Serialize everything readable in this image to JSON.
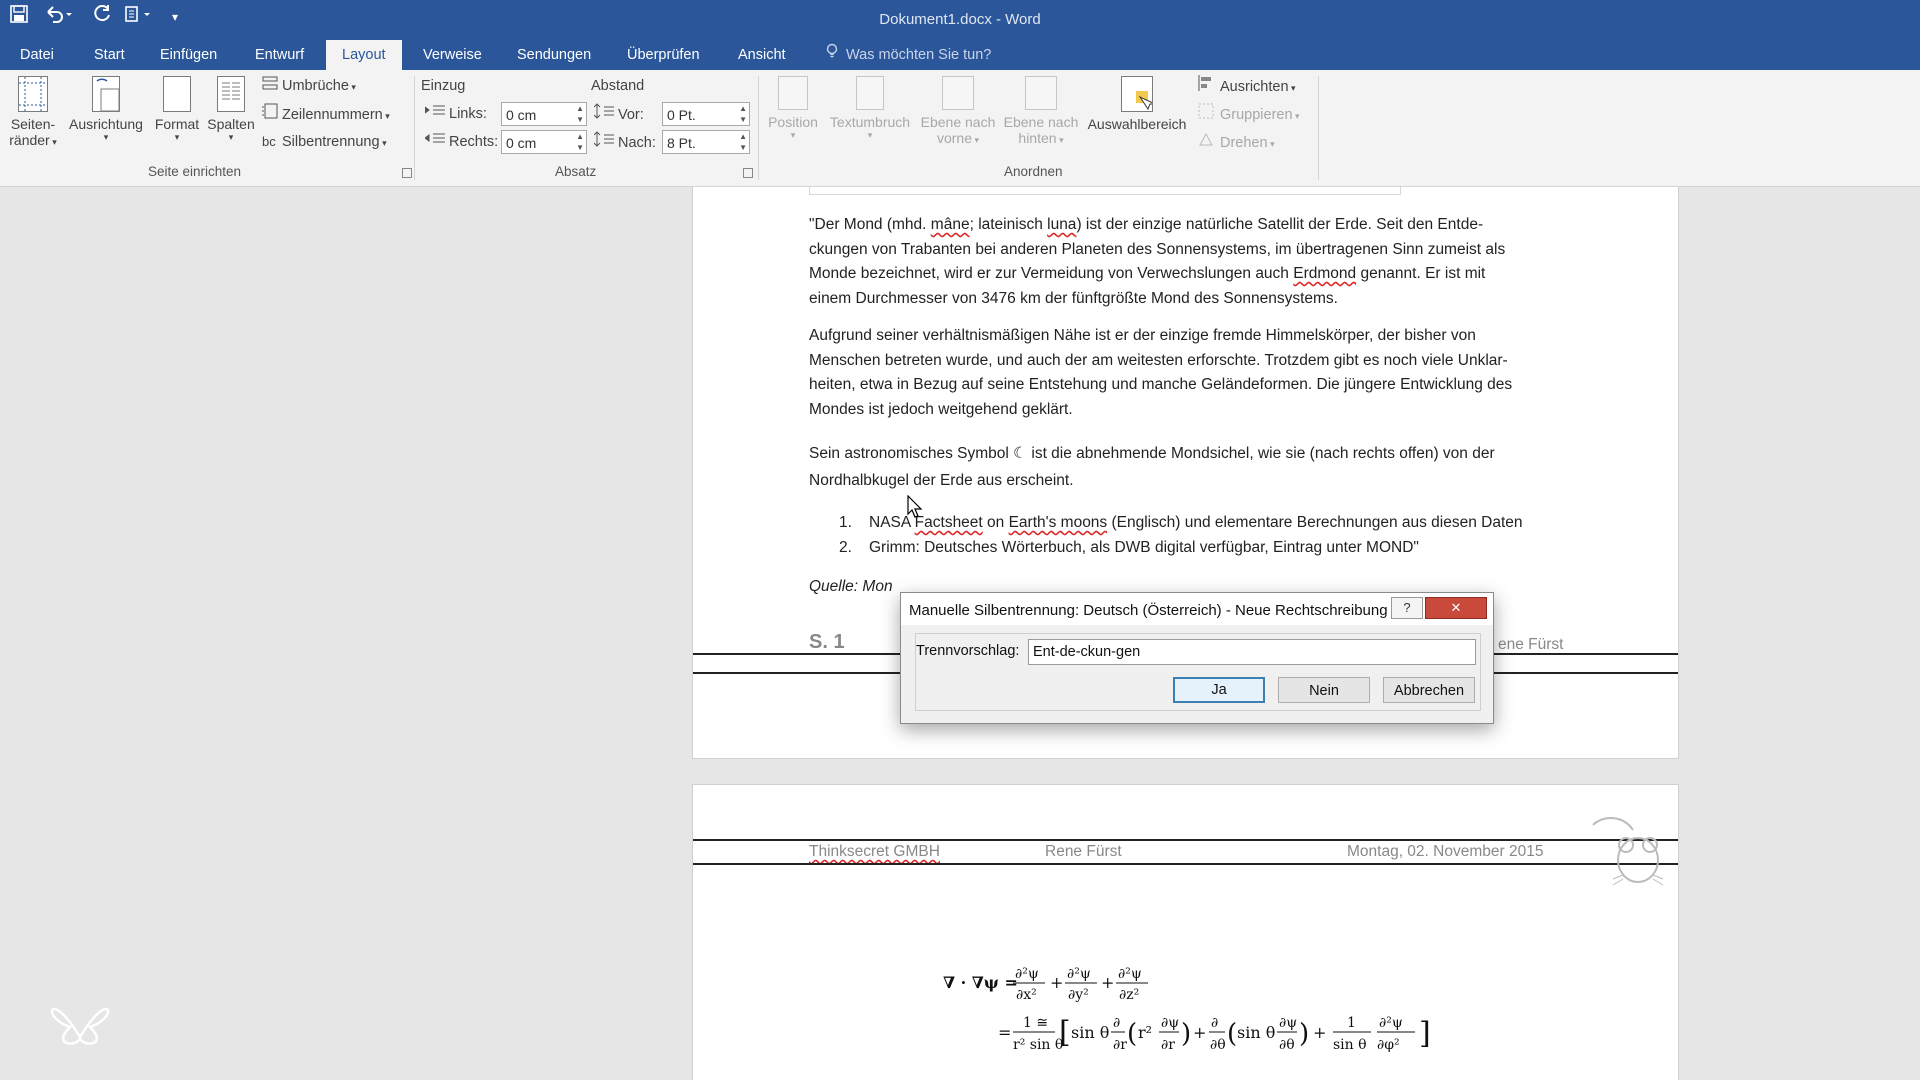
{
  "window": {
    "title": "Dokument1.docx - Word"
  },
  "tabs": [
    {
      "label": "Datei"
    },
    {
      "label": "Start"
    },
    {
      "label": "Einfügen"
    },
    {
      "label": "Entwurf"
    },
    {
      "label": "Layout"
    },
    {
      "label": "Verweise"
    },
    {
      "label": "Sendungen"
    },
    {
      "label": "Überprüfen"
    },
    {
      "label": "Ansicht"
    }
  ],
  "tell_me": "Was möchten Sie tun?",
  "ribbon": {
    "seite_einrichten": {
      "label": "Seite einrichten",
      "seitenraender_1": "Seiten-",
      "seitenraender_2": "ränder",
      "ausrichtung": "Ausrichtung",
      "format": "Format",
      "spalten": "Spalten",
      "umbrueche": "Umbrüche",
      "zeilennummern": "Zeilennummern",
      "silbentrennung": "Silbentrennung"
    },
    "absatz": {
      "label": "Absatz",
      "einzug": "Einzug",
      "abstand": "Abstand",
      "links_label": "Links:",
      "links_value": "0 cm",
      "rechts_label": "Rechts:",
      "rechts_value": "0 cm",
      "vor_label": "Vor:",
      "vor_value": "0 Pt.",
      "nach_label": "Nach:",
      "nach_value": "8 Pt."
    },
    "anordnen": {
      "label": "Anordnen",
      "position": "Position",
      "textumbruch": "Textumbruch",
      "ebene_vorne_1": "Ebene nach",
      "ebene_vorne_2": "vorne",
      "ebene_hinten_1": "Ebene nach",
      "ebene_hinten_2": "hinten",
      "auswahlbereich": "Auswahlbereich",
      "ausrichten": "Ausrichten",
      "gruppieren": "Gruppieren",
      "drehen": "Drehen"
    }
  },
  "document": {
    "para1": {
      "a": "\"Der Mond (mhd. ",
      "b": "mâne",
      "c": "; lateinisch ",
      "d": "luna",
      "e": ") ist der einzige natürliche Satellit der Erde. Seit den Entde-",
      "line2": "ckungen von Trabanten bei anderen Planeten des Sonnensystems, im übertragenen Sinn zumeist als",
      "l3a": "Monde bezeichnet, wird er zur Vermeidung von Verwechslungen auch ",
      "l3b": "Erdmond",
      "l3c": " genannt. Er ist mit",
      "line4": "einem Durchmesser von 3476 km der fünftgrößte Mond des Sonnensystems."
    },
    "para2": [
      "Aufgrund seiner verhältnismäßigen Nähe ist er der einzige fremde Himmelskörper, der bisher von",
      "Menschen betreten wurde, und auch der am weitesten erforschte. Trotzdem gibt es noch viele Unklar-",
      "heiten, etwa in Bezug auf seine Entstehung und manche Geländeformen. Die jüngere Entwicklung des",
      "Mondes ist jedoch weitgehend geklärt."
    ],
    "para3": [
      "Sein astronomisches Symbol ☾ ist die abnehmende Mondsichel, wie sie (nach rechts offen) von der",
      "Nordhalbkugel der Erde aus erscheint."
    ],
    "list": [
      {
        "num": "1.",
        "a": "NASA ",
        "b": "Factsheet",
        "c": " on ",
        "d": "Earth's moons",
        "e": " (Englisch) und elementare Berechnungen aus diesen Daten"
      },
      {
        "num": "2.",
        "text": "Grimm: Deutsches Wörterbuch, als DWB digital verfügbar, Eintrag unter MOND\""
      }
    ],
    "quelle": "Quelle: Mon",
    "page1_footer": {
      "page": "S. 1",
      "right": "ene Fürst"
    },
    "page2_header": {
      "company": "Thinksecret GMBH",
      "author": "Rene Fürst",
      "date": "Montag, 02. November 2015"
    }
  },
  "dialog": {
    "title": "Manuelle Silbentrennung: Deutsch (Österreich) - Neue Rechtschreibung",
    "help": "?",
    "close": "✕",
    "field_label": "Trennvorschlag:",
    "field_value": "Ent-de-ckun-gen",
    "yes": "Ja",
    "no": "Nein",
    "cancel": "Abbrechen"
  },
  "icons": {
    "save": "save-icon",
    "undo": "undo-icon",
    "redo": "redo-icon",
    "lightbulb": "lightbulb-icon",
    "mouse_logo": "mouse-logo-icon",
    "butterfly": "butterfly-logo-icon"
  },
  "colors": {
    "word_blue": "#2b579a",
    "ribbon_bg": "#f3f3f3",
    "close_red": "#c94a3a"
  }
}
